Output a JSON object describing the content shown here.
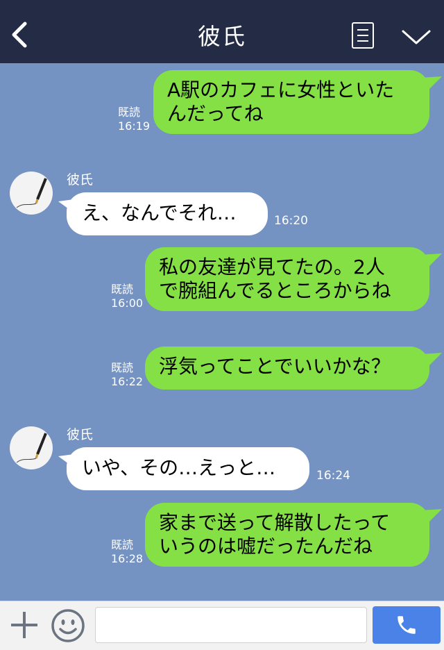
{
  "header": {
    "title": "彼氏",
    "back_icon": "chevron-left-icon",
    "menu_icon": "notes-icon",
    "toggle_icon": "chevron-down-icon",
    "background": "#232c44"
  },
  "chat": {
    "background": "#7492c2",
    "bubble_colors": {
      "outgoing": "#84e045",
      "incoming": "#ffffff"
    },
    "messages": [
      {
        "direction": "out",
        "line1": "A駅のカフェに女性といた",
        "line2": "んだってね",
        "read": "既読",
        "time": "16:19"
      },
      {
        "direction": "in",
        "sender": "彼氏",
        "text": "え、なんでそれ…",
        "time": "16:20"
      },
      {
        "direction": "out",
        "line1": "私の友達が見てたの。2人",
        "line2": "で腕組んでるところからね",
        "read": "既読",
        "time": "16:00"
      },
      {
        "direction": "out",
        "line1": "浮気ってことでいいかな？",
        "read": "既読",
        "time": "16:22"
      },
      {
        "direction": "in",
        "sender": "彼氏",
        "text": "いや、その…えっと…",
        "time": "16:24"
      },
      {
        "direction": "out",
        "line1": "家まで送って解散したって",
        "line2": "いうのは嘘だったんだね",
        "read": "既読",
        "time": "16:28"
      }
    ]
  },
  "input_bar": {
    "plus_icon": "plus-icon",
    "emoji_icon": "smiley-icon",
    "text_value": "",
    "call_icon": "phone-icon",
    "call_color": "#4a82e8"
  }
}
